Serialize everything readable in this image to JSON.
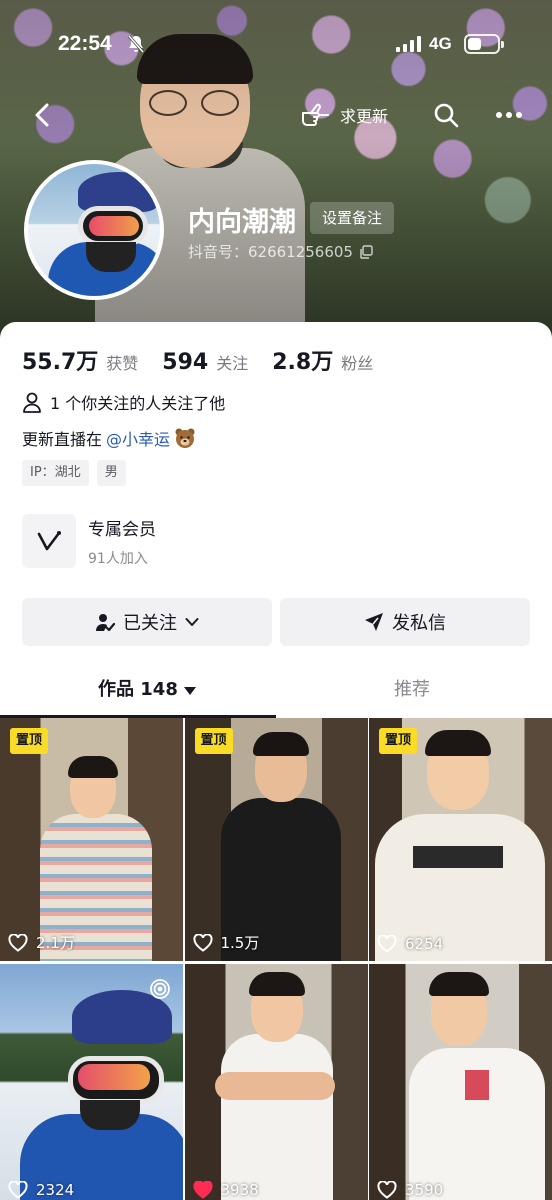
{
  "status_bar": {
    "time": "22:54",
    "network": "4G",
    "battery_level": 0.45
  },
  "nav": {
    "request_update_label": "求更新"
  },
  "profile": {
    "name": "内向潮潮",
    "remark_button": "设置备注",
    "douyin_id": "抖音号：62661256605"
  },
  "stats": [
    {
      "value": "55.7万",
      "label": "获赞"
    },
    {
      "value": "594",
      "label": "关注"
    },
    {
      "value": "2.8万",
      "label": "粉丝"
    }
  ],
  "mutual_text": "1 个你关注的人关注了他",
  "bio": {
    "text": "更新直播在",
    "mention": "@小幸运"
  },
  "tags": [
    "IP：湖北",
    "男"
  ],
  "member": {
    "title": "专属会员",
    "subtitle": "91人加入"
  },
  "actions": {
    "following": "已关注",
    "message": "发私信"
  },
  "tabs": {
    "works": "作品 148",
    "recommend": "推荐"
  },
  "videos": [
    {
      "pinned": true,
      "pin_label": "置顶",
      "likes": "2.1万",
      "liked": false
    },
    {
      "pinned": true,
      "pin_label": "置顶",
      "likes": "1.5万",
      "liked": false
    },
    {
      "pinned": true,
      "pin_label": "置顶",
      "likes": "6254",
      "liked": false
    },
    {
      "pinned": false,
      "pin_label": "",
      "likes": "2324",
      "liked": false
    },
    {
      "pinned": false,
      "pin_label": "",
      "likes": "3938",
      "liked": true
    },
    {
      "pinned": false,
      "pin_label": "",
      "likes": "3590",
      "liked": false
    }
  ],
  "colors": {
    "pin": "#fadc27",
    "liked_heart": "#fe2c55",
    "mention": "#2a5db0"
  }
}
